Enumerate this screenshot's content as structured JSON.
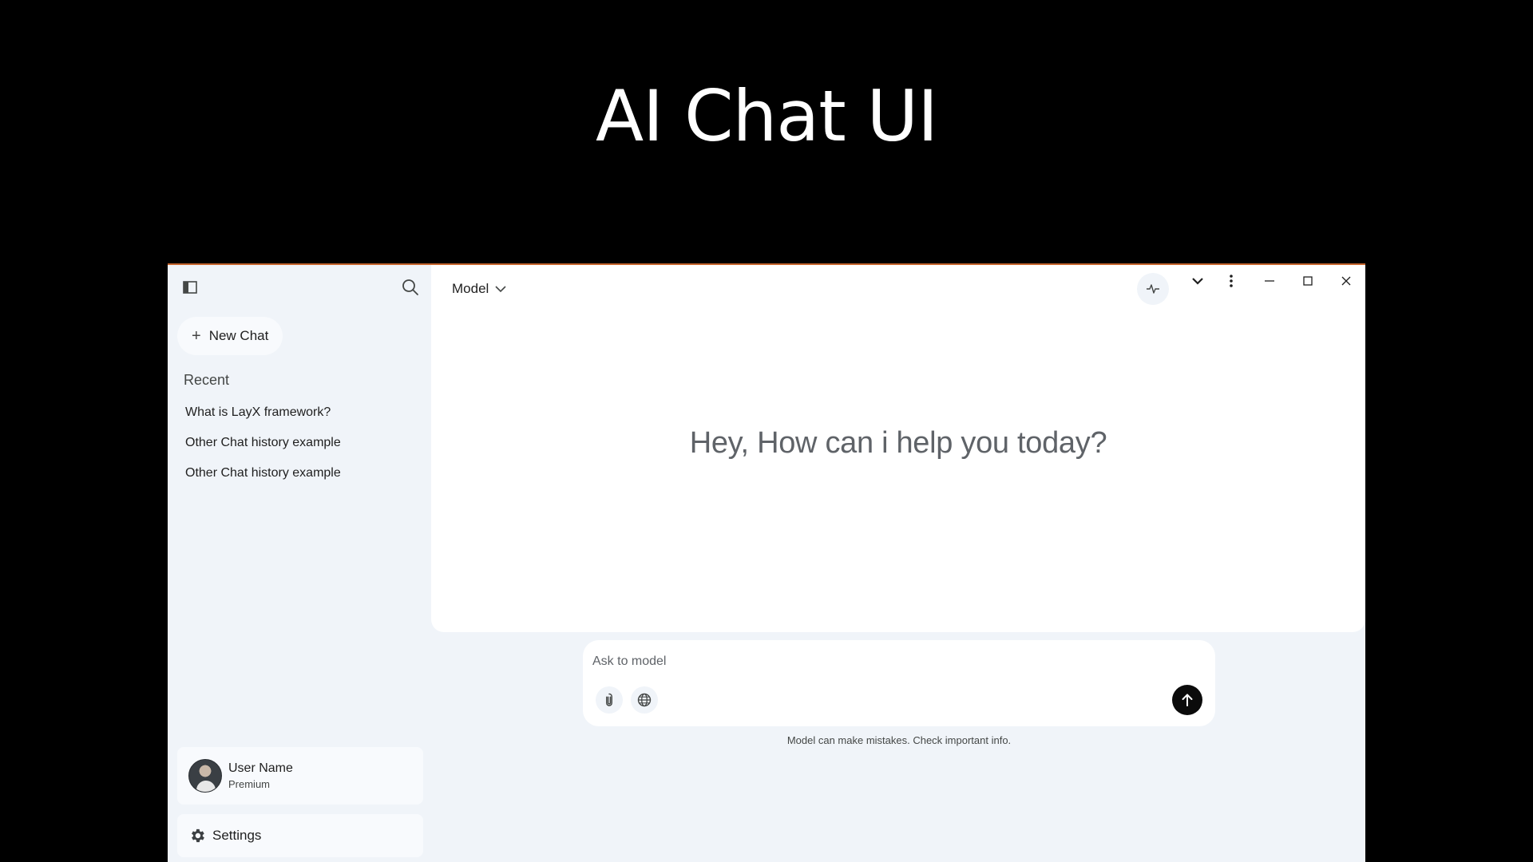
{
  "header": {
    "title": "AI Chat UI"
  },
  "sidebar": {
    "new_chat_label": "New Chat",
    "recent_heading": "Recent",
    "history": [
      {
        "label": "What is LayX framework?"
      },
      {
        "label": "Other Chat history example"
      },
      {
        "label": "Other Chat history example"
      }
    ],
    "user": {
      "name": "User Name",
      "plan": "Premium"
    },
    "settings_label": "Settings"
  },
  "main": {
    "model_label": "Model",
    "greeting": "Hey, How can i help you today?"
  },
  "composer": {
    "placeholder": "Ask to model",
    "disclaimer": "Model can make mistakes. Check important info."
  },
  "colors": {
    "page_background": "#000000",
    "window_background": "#f0f4f9",
    "panel_background": "#ffffff",
    "send_button": "#0b0b0b"
  },
  "icons": [
    "sidebar-toggle-icon",
    "search-icon",
    "plus-icon",
    "chevron-down-icon",
    "activity-icon",
    "more-vertical-icon",
    "minimize-icon",
    "maximize-icon",
    "close-icon",
    "paperclip-icon",
    "globe-icon",
    "arrow-up-icon",
    "gear-icon"
  ]
}
